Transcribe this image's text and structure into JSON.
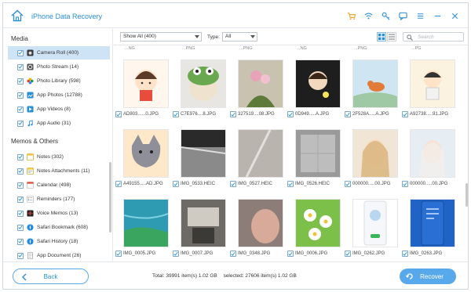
{
  "app": {
    "title": "iPhone Data Recovery"
  },
  "colors": {
    "accent": "#2b8fd6",
    "selected_row": "#cfe3f7",
    "button": "#58a9ec"
  },
  "titlebar": {
    "icons": [
      "cart-icon",
      "wifi-icon",
      "key-icon",
      "chat-icon",
      "menu-icon",
      "minimize-icon",
      "close-icon"
    ]
  },
  "sidebar": {
    "media_title": "Media",
    "media_items": [
      {
        "label": "Camera Roll (400)",
        "icon": "camera-icon",
        "selected": true
      },
      {
        "label": "Photo Stream (14)",
        "icon": "photo-stream-icon"
      },
      {
        "label": "Photo Library (598)",
        "icon": "photo-library-icon"
      },
      {
        "label": "App Photos (12788)",
        "icon": "app-photos-icon"
      },
      {
        "label": "App Videos (8)",
        "icon": "app-videos-icon"
      },
      {
        "label": "App Audio (31)",
        "icon": "music-icon"
      }
    ],
    "memos_title": "Memos & Others",
    "memos_items": [
      {
        "label": "Notes (302)",
        "icon": "notes-icon"
      },
      {
        "label": "Notes Attachments (11)",
        "icon": "attachments-icon"
      },
      {
        "label": "Calendar (498)",
        "icon": "calendar-icon"
      },
      {
        "label": "Reminders (177)",
        "icon": "reminders-icon"
      },
      {
        "label": "Voice Memos (13)",
        "icon": "voice-memo-icon"
      },
      {
        "label": "Safari Bookmark (608)",
        "icon": "safari-icon"
      },
      {
        "label": "Safari History (18)",
        "icon": "safari-icon"
      },
      {
        "label": "App Document (26)",
        "icon": "document-icon"
      }
    ]
  },
  "toolbar": {
    "show_select": "Show All (400)",
    "type_label": "Type:",
    "type_select": "All",
    "search_placeholder": "Search"
  },
  "grid": {
    "top_partial": [
      "...NG",
      "...PNG",
      "...PNG",
      "...NG",
      "...PNG",
      "...PG"
    ],
    "rows": [
      [
        {
          "name": "AD803......0.JPG"
        },
        {
          "name": "C7E976....8.JPG"
        },
        {
          "name": "327519....08.JPG"
        },
        {
          "name": "0D949.....A.JPG"
        },
        {
          "name": "2F528A.....A.JPG"
        },
        {
          "name": "A92738.....91.JPG"
        }
      ],
      [
        {
          "name": "A49155.....AD.JPG"
        },
        {
          "name": "IMG_0533.HEIC"
        },
        {
          "name": "IMG_0527.HEIC"
        },
        {
          "name": "IMG_0526.HEIC"
        },
        {
          "name": "000000.....00.JPG"
        },
        {
          "name": "000000.....00.JPG"
        }
      ],
      [
        {
          "name": "IMG_0005.JPG"
        },
        {
          "name": "IMG_0007.JPG"
        },
        {
          "name": "IMG_0348.JPG"
        },
        {
          "name": "IMG_0006.JPG"
        },
        {
          "name": "IMG_0262.JPG"
        },
        {
          "name": "IMG_0263.JPG"
        }
      ]
    ]
  },
  "footer": {
    "back_label": "Back",
    "total_text": "Total: 39991 item(s) 1.02 GB",
    "selected_text": "selected: 27606 item(s) 1.02 GB",
    "recover_label": "Recover"
  }
}
